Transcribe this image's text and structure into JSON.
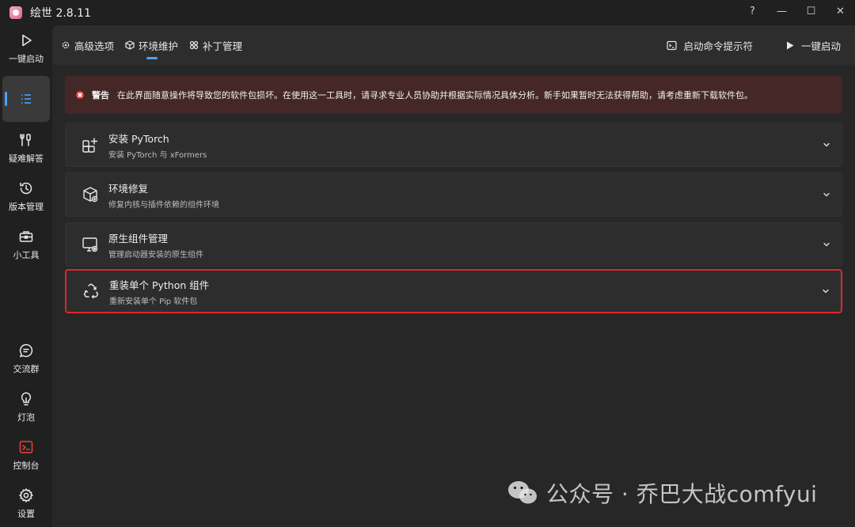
{
  "app": {
    "title": "绘世 2.8.11"
  },
  "window_controls": {
    "help": "?",
    "minimize": "—",
    "maximize": "☐",
    "close": "✕"
  },
  "sidebar": {
    "items": [
      {
        "label": "一键启动",
        "icon": "play-icon"
      },
      {
        "label": "",
        "icon": "list-icon",
        "active": true
      },
      {
        "label": "疑难解答",
        "icon": "tools-icon"
      },
      {
        "label": "版本管理",
        "icon": "history-icon"
      },
      {
        "label": "小工具",
        "icon": "toolbox-icon"
      },
      {
        "label": "交流群",
        "icon": "chat-icon"
      },
      {
        "label": "灯泡",
        "icon": "lightbulb-icon"
      },
      {
        "label": "控制台",
        "icon": "console-icon"
      },
      {
        "label": "设置",
        "icon": "gear-icon"
      }
    ]
  },
  "tabs": [
    {
      "label": "高级选项",
      "icon": "gear-icon"
    },
    {
      "label": "环境维护",
      "icon": "package-icon",
      "active": true
    },
    {
      "label": "补丁管理",
      "icon": "puzzle-icon"
    }
  ],
  "top_actions": {
    "console_prompt": "启动命令提示符",
    "launch": "一键启动"
  },
  "warning": {
    "title": "警告",
    "message": "在此界面随意操作将导致您的软件包损坏。在使用这一工具时，请寻求专业人员协助并根据实际情况具体分析。新手如果暂时无法获得帮助，请考虑重新下载软件包。"
  },
  "cards": [
    {
      "title": "安装 PyTorch",
      "subtitle": "安装 PyTorch 与 xFormers",
      "icon": "add-grid-icon"
    },
    {
      "title": "环境修复",
      "subtitle": "修复内核与插件依赖的组件环境",
      "icon": "repair-box-icon"
    },
    {
      "title": "原生组件管理",
      "subtitle": "管理启动器安装的原生组件",
      "icon": "monitor-settings-icon"
    },
    {
      "title": "重装单个 Python 组件",
      "subtitle": "重新安装单个 Pip 软件包",
      "icon": "recycle-icon",
      "highlighted": true
    }
  ],
  "watermark": {
    "text": "公众号 · 乔巴大战comfyui"
  },
  "colors": {
    "accent": "#4aa3ff",
    "highlight_border": "#e0262c",
    "warning_bg": "#442726"
  }
}
